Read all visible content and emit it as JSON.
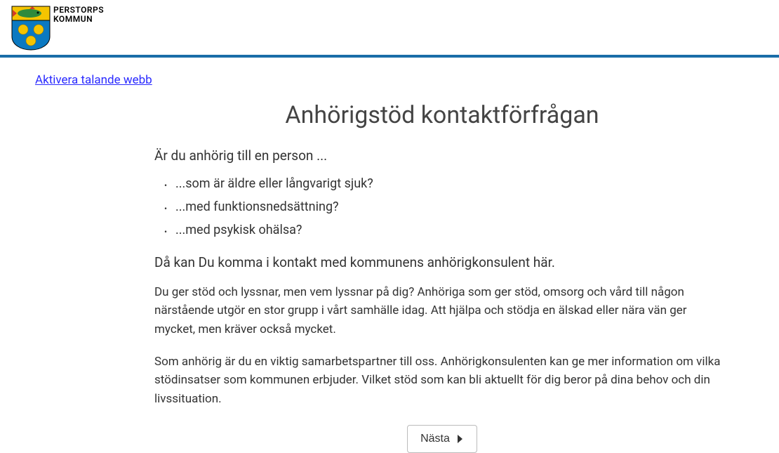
{
  "header": {
    "org_line1": "PERSTORPS",
    "org_line2": "KOMMUN"
  },
  "links": {
    "activate_talking_web": "Aktivera talande webb"
  },
  "main": {
    "title": "Anhörigstöd kontaktförfrågan",
    "lead": "Är du anhörig till en person ...",
    "bullets": [
      "...som är äldre eller långvarigt sjuk?",
      "...med funktionsnedsättning?",
      "...med psykisk ohälsa?"
    ],
    "subhead": "Då kan Du komma i kontakt med kommunens anhörigkonsulent här.",
    "para1": "Du ger stöd och lyssnar, men vem lyssnar på dig? Anhöriga som ger stöd, omsorg och vård till någon närstående utgör en stor grupp i vårt samhälle idag. Att hjälpa och stödja en älskad eller nära vän ger mycket, men kräver också mycket.",
    "para2": "Som anhörig är du en viktig samarbetspartner till oss. Anhörigkonsulenten kan ge mer information om vilka stödinsatser som kommunen erbjuder. Vilket stöd som kan bli aktuellt för dig beror på dina behov och din livssituation.",
    "next_label": "Nästa"
  },
  "colors": {
    "accent": "#1a6da8",
    "shield_blue": "#0b79c1",
    "shield_yellow": "#f5c400",
    "fish_green": "#2f8a3c",
    "fish_red": "#d43a2a"
  }
}
